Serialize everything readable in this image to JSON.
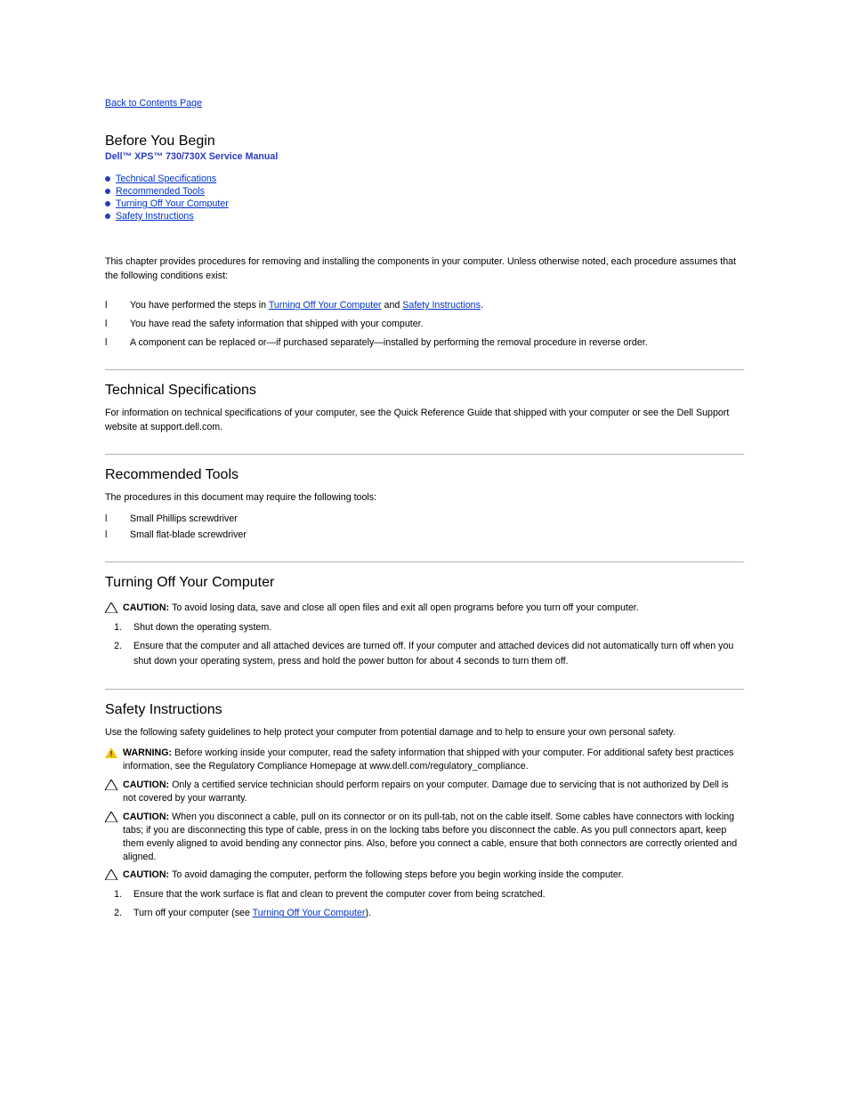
{
  "nav": {
    "back": "Back to Contents Page"
  },
  "title": "Before You Begin",
  "subtitle": "Dell™ XPS™ 730/730X Service Manual",
  "toc": [
    {
      "label": "Technical Specifications",
      "href": "#specs"
    },
    {
      "label": "Recommended Tools",
      "href": "#tools"
    },
    {
      "label": "Turning Off Your Computer",
      "href": "#turnoff"
    },
    {
      "label": "Safety Instructions",
      "href": "#safety"
    }
  ],
  "intro": {
    "para": "This chapter provides procedures for removing and installing the components in your computer. Unless otherwise noted, each procedure assumes that the following conditions exist:",
    "bullets": [
      {
        "pre": "You have performed the steps in ",
        "link1": "Turning Off Your Computer",
        "mid": " and ",
        "link2": "Safety Instructions",
        "post": "."
      },
      {
        "pre": "You have read the safety information that shipped with your computer.",
        "link1": "",
        "mid": "",
        "link2": "",
        "post": ""
      },
      {
        "pre": "A component can be replaced or—if purchased separately—installed by performing the removal procedure in reverse order.",
        "link1": "",
        "mid": "",
        "link2": "",
        "post": ""
      }
    ]
  },
  "sections": {
    "specs": {
      "title": "Technical Specifications",
      "body": "For information on technical specifications of your computer, see the Quick Reference Guide that shipped with your computer or see the Dell Support website at support.dell.com."
    },
    "tools": {
      "title": "Recommended Tools",
      "lead": "The procedures in this document may require the following tools:",
      "items": [
        "Small Phillips screwdriver",
        "Small flat-blade screwdriver"
      ]
    },
    "turnoff": {
      "title": "Turning Off Your Computer",
      "caution": {
        "label": "CAUTION: ",
        "text": "To avoid losing data, save and close all open files and exit all open programs before you turn off your computer."
      },
      "steps": [
        "Shut down the operating system.",
        "Ensure that the computer and all attached devices are turned off. If your computer and attached devices did not automatically turn off when you shut down your operating system, press and hold the power button for about 4 seconds to turn them off."
      ]
    },
    "safety": {
      "title": "Safety Instructions",
      "lead": "Use the following safety guidelines to help protect your computer from potential damage and to help to ensure your own personal safety.",
      "alerts": [
        {
          "type": "warning",
          "label": "WARNING: ",
          "text": "Before working inside your computer, read the safety information that shipped with your computer. For additional safety best practices information, see the Regulatory Compliance Homepage at www.dell.com/regulatory_compliance."
        },
        {
          "type": "caution",
          "label": "CAUTION: ",
          "text": "Only a certified service technician should perform repairs on your computer. Damage due to servicing that is not authorized by Dell is not covered by your warranty."
        },
        {
          "type": "caution",
          "label": "CAUTION: ",
          "text": "When you disconnect a cable, pull on its connector or on its pull-tab, not on the cable itself. Some cables have connectors with locking tabs; if you are disconnecting this type of cable, press in on the locking tabs before you disconnect the cable. As you pull connectors apart, keep them evenly aligned to avoid bending any connector pins. Also, before you connect a cable, ensure that both connectors are correctly oriented and aligned."
        },
        {
          "type": "caution",
          "label": "CAUTION: ",
          "text": "To avoid damaging the computer, perform the following steps before you begin working inside the computer."
        }
      ],
      "steps": [
        {
          "pre": "Ensure that the work surface is flat and clean to prevent the computer cover from being scratched.",
          "link": "",
          "post": ""
        },
        {
          "pre": "Turn off your computer (see ",
          "link": "Turning Off Your Computer",
          "post": ")."
        }
      ]
    }
  }
}
